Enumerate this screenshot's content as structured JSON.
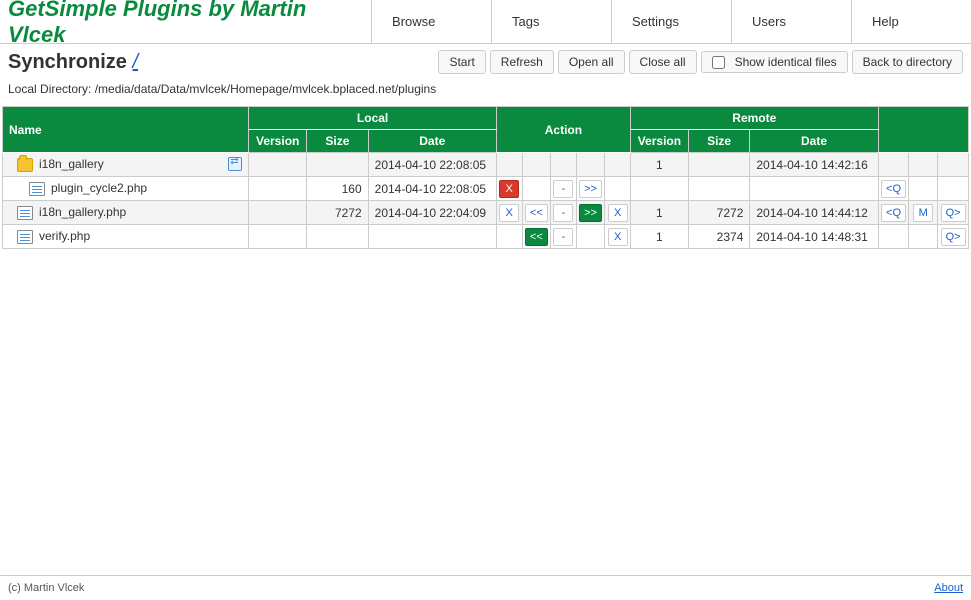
{
  "header": {
    "site_title": "GetSimple Plugins by Martin Vlcek",
    "nav": [
      "Browse",
      "Tags",
      "Settings",
      "Users",
      "Help"
    ]
  },
  "page": {
    "title": "Synchronize",
    "slash": "/",
    "local_dir_label": "Local Directory: /media/data/Data/mvlcek/Homepage/mvlcek.bplaced.net/plugins"
  },
  "toolbar": {
    "start": "Start",
    "refresh": "Refresh",
    "open_all": "Open all",
    "close_all": "Close all",
    "show_identical": "Show identical files",
    "back": "Back to directory"
  },
  "table": {
    "headers": {
      "name": "Name",
      "local": "Local",
      "action": "Action",
      "remote": "Remote",
      "version": "Version",
      "size": "Size",
      "date": "Date"
    },
    "rows": [
      {
        "type": "folder",
        "name": "i18n_gallery",
        "local": {
          "version": "",
          "size": "",
          "date": "2014-04-10 22:08:05"
        },
        "remote": {
          "version": "1",
          "size": "",
          "date": "2014-04-10 14:42:16"
        },
        "actions": {
          "x_red": "",
          "ll": "",
          "dash": "",
          "rr": "",
          "x_link": "",
          "lq": "",
          "m": "",
          "rq": ""
        },
        "sync_badge": true,
        "indent": 0
      },
      {
        "type": "file",
        "name": "plugin_cycle2.php",
        "local": {
          "version": "",
          "size": "160",
          "date": "2014-04-10 22:08:05"
        },
        "remote": {
          "version": "",
          "size": "",
          "date": ""
        },
        "actions": {
          "x_red": "X",
          "ll": "",
          "dash": "-",
          "rr": ">>",
          "x_link": "",
          "lq": "<Q",
          "m": "",
          "rq": ""
        },
        "indent": 1
      },
      {
        "type": "file",
        "name": "i18n_gallery.php",
        "local": {
          "version": "",
          "size": "7272",
          "date": "2014-04-10 22:04:09"
        },
        "remote": {
          "version": "1",
          "size": "7272",
          "date": "2014-04-10 14:44:12"
        },
        "actions": {
          "x_red": "X",
          "ll": "<<",
          "dash": "-",
          "rr": ">>",
          "x_link": "X",
          "lq": "<Q",
          "m": "M",
          "rq": "Q>"
        },
        "x_red_style": "link",
        "rr_style": "green",
        "indent": 0
      },
      {
        "type": "file",
        "name": "verify.php",
        "local": {
          "version": "",
          "size": "",
          "date": ""
        },
        "remote": {
          "version": "1",
          "size": "2374",
          "date": "2014-04-10 14:48:31"
        },
        "actions": {
          "x_red": "",
          "ll": "<<",
          "dash": "-",
          "rr": "",
          "x_link": "X",
          "lq": "",
          "m": "",
          "rq": "Q>"
        },
        "ll_style": "green",
        "indent": 0
      }
    ]
  },
  "footer": {
    "copyright": "(c) Martin Vlcek",
    "about": "About"
  }
}
